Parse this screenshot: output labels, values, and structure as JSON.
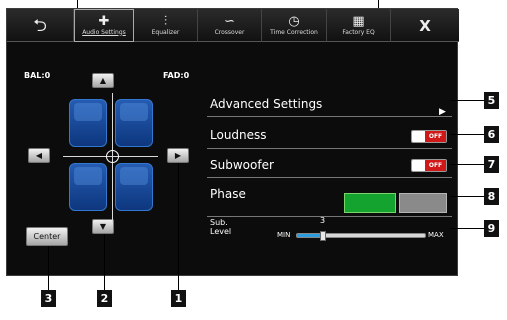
{
  "topbar": {
    "back_glyph": "⮌",
    "tabs": [
      {
        "label": "Audio Settings",
        "glyph": "✚",
        "icon": "plus-icon",
        "active": true
      },
      {
        "label": "Equalizer",
        "glyph": "⫶",
        "icon": "equalizer-sliders-icon"
      },
      {
        "label": "Crossover",
        "glyph": "∽",
        "icon": "crossover-wave-icon"
      },
      {
        "label": "Time Correction",
        "glyph": "◷",
        "icon": "clock-icon"
      },
      {
        "label": "Factory EQ",
        "glyph": "▦",
        "icon": "grid-icon"
      }
    ],
    "close_glyph": "X"
  },
  "balance": {
    "bal_label": "BAL:0",
    "fad_label": "FAD:0",
    "up_glyph": "▲",
    "down_glyph": "▼",
    "left_glyph": "◀",
    "right_glyph": "▶",
    "center_label": "Center"
  },
  "settings": {
    "advanced_label": "Advanced Settings",
    "advanced_arrow": "▶",
    "loudness_label": "Loudness",
    "loudness_state": "OFF",
    "subwoofer_label": "Subwoofer",
    "subwoofer_state": "OFF",
    "phase_label": "Phase",
    "sub_level_label_1": "Sub.",
    "sub_level_label_2": "Level",
    "sub_level_value": "3",
    "sub_level_fraction": 0.2,
    "sub_min": "MIN",
    "sub_max": "MAX"
  },
  "callouts": [
    "1",
    "2",
    "3",
    "5",
    "6",
    "7",
    "8",
    "9"
  ],
  "colors": {
    "toggle_off": "#d01818",
    "phase_active": "#14a32f",
    "phase_inactive": "#8a8a8a",
    "slider_fill": "#2d9de0",
    "seat_blue": "#1f5bc0"
  }
}
